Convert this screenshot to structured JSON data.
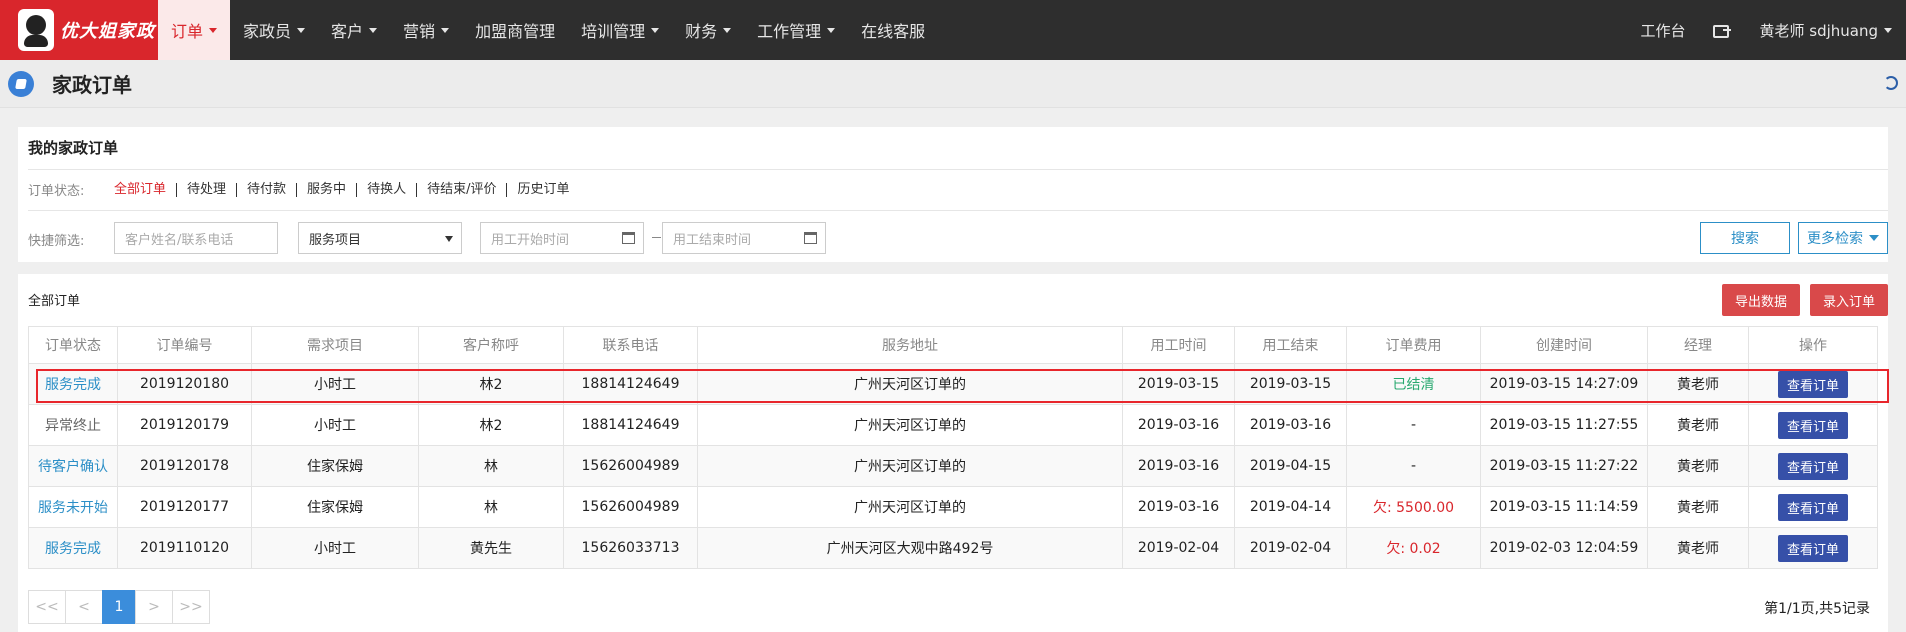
{
  "brand": {
    "logo_text": "优大姐家政",
    "accent": "#d9262c"
  },
  "nav": {
    "items": [
      {
        "label": "订单",
        "dropdown": true,
        "active": true
      },
      {
        "label": "家政员",
        "dropdown": true
      },
      {
        "label": "客户",
        "dropdown": true
      },
      {
        "label": "营销",
        "dropdown": true
      },
      {
        "label": "加盟商管理",
        "dropdown": false
      },
      {
        "label": "培训管理",
        "dropdown": true
      },
      {
        "label": "财务",
        "dropdown": true
      },
      {
        "label": "工作管理",
        "dropdown": true
      },
      {
        "label": "在线客服",
        "dropdown": false
      }
    ],
    "workbench": "工作台",
    "user": "黄老师 sdjhuang"
  },
  "page": {
    "title": "家政订单"
  },
  "filters": {
    "panel_title": "我的家政订单",
    "status_label": "订单状态:",
    "statuses": [
      "全部订单",
      "待处理",
      "待付款",
      "服务中",
      "待换人",
      "待结束/评价",
      "历史订单"
    ],
    "quick_label": "快捷筛选:",
    "customer_placeholder": "客户姓名/联系电话",
    "service_select": "服务项目",
    "start_placeholder": "用工开始时间",
    "end_placeholder": "用工结束时间",
    "search_label": "搜索",
    "more_label": "更多检索"
  },
  "orders": {
    "panel_title": "全部订单",
    "export_label": "导出数据",
    "add_label": "录入订单",
    "columns": [
      "订单状态",
      "订单编号",
      "需求项目",
      "客户称呼",
      "联系电话",
      "服务地址",
      "用工时间",
      "用工结束",
      "订单费用",
      "创建时间",
      "经理",
      "操作"
    ],
    "rows": [
      {
        "status": "服务完成",
        "status_kind": "blue",
        "id": "2019120180",
        "item": "小时工",
        "customer": "林2",
        "phone": "18814124649",
        "address": "广州天河区订单的",
        "start": "2019-03-15",
        "end": "2019-03-15",
        "fee": "已结清",
        "fee_kind": "green",
        "created": "2019-03-15 14:27:09",
        "manager": "黄老师",
        "action": "查看订单"
      },
      {
        "status": "异常终止",
        "status_kind": "gray",
        "id": "2019120179",
        "item": "小时工",
        "customer": "林2",
        "phone": "18814124649",
        "address": "广州天河区订单的",
        "start": "2019-03-16",
        "end": "2019-03-16",
        "fee": "-",
        "fee_kind": "plain",
        "created": "2019-03-15 11:27:55",
        "manager": "黄老师",
        "action": "查看订单"
      },
      {
        "status": "待客户确认",
        "status_kind": "blue",
        "id": "2019120178",
        "item": "住家保姆",
        "customer": "林",
        "phone": "15626004989",
        "address": "广州天河区订单的",
        "start": "2019-03-16",
        "end": "2019-04-15",
        "fee": "-",
        "fee_kind": "plain",
        "created": "2019-03-15 11:27:22",
        "manager": "黄老师",
        "action": "查看订单"
      },
      {
        "status": "服务未开始",
        "status_kind": "blue",
        "id": "2019120177",
        "item": "住家保姆",
        "customer": "林",
        "phone": "15626004989",
        "address": "广州天河区订单的",
        "start": "2019-03-16",
        "end": "2019-04-14",
        "fee": "欠: 5500.00",
        "fee_kind": "red",
        "created": "2019-03-15 11:14:59",
        "manager": "黄老师",
        "action": "查看订单"
      },
      {
        "status": "服务完成",
        "status_kind": "blue",
        "id": "2019110120",
        "item": "小时工",
        "customer": "黄先生",
        "phone": "15626033713",
        "address": "广州天河区大观中路492号",
        "start": "2019-02-04",
        "end": "2019-02-04",
        "fee": "欠: 0.02",
        "fee_kind": "red",
        "created": "2019-02-03 12:04:59",
        "manager": "黄老师",
        "action": "查看订单"
      }
    ]
  },
  "pagination": {
    "first": "<<",
    "prev": "<",
    "current": "1",
    "next": ">",
    "last": ">>",
    "info": "第1/1页,共5记录"
  }
}
